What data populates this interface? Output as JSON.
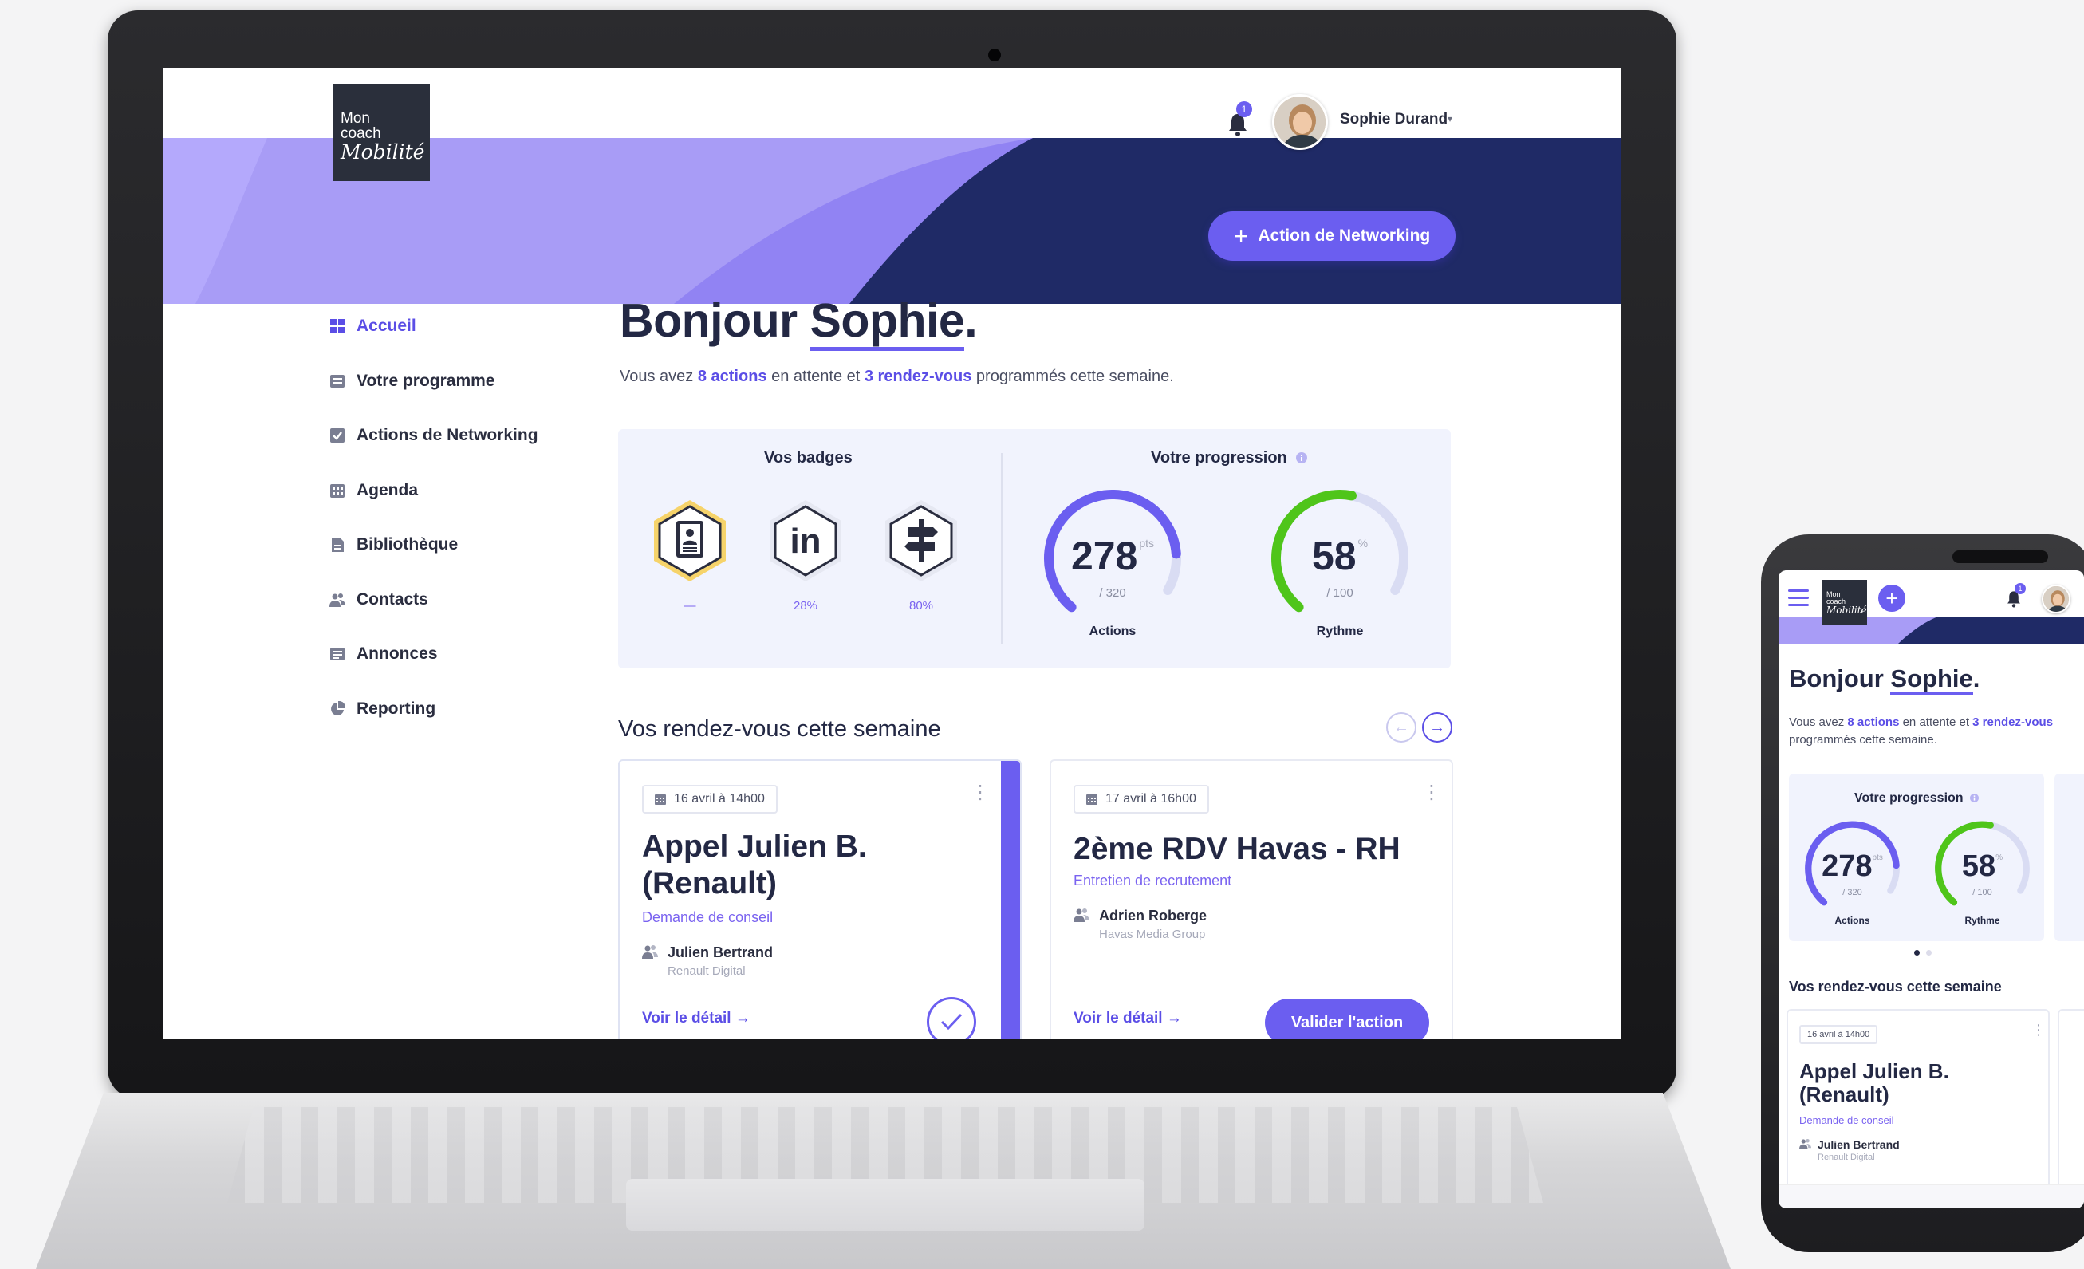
{
  "colors": {
    "accent": "#6b5ef0",
    "navy": "#1f2a66",
    "light_band": "#a89cf6",
    "success": "#4fc51a",
    "text": "#232844"
  },
  "app": {
    "logo_line1": "Mon",
    "logo_line2": "coach",
    "logo_line3": "Mobilité"
  },
  "header": {
    "notifications_count": "1",
    "notification_icon": "bell-icon",
    "user_name": "Sophie Durand",
    "user_caret": "▾",
    "primary_action_icon": "plus-icon",
    "primary_action_label": "Action de Networking"
  },
  "sidebar": {
    "items": [
      {
        "label": "Accueil",
        "icon": "grid-icon",
        "active": true
      },
      {
        "label": "Votre programme",
        "icon": "list-icon",
        "active": false
      },
      {
        "label": "Actions de Networking",
        "icon": "checkbox-icon",
        "active": false
      },
      {
        "label": "Agenda",
        "icon": "calendar-icon",
        "active": false
      },
      {
        "label": "Bibliothèque",
        "icon": "document-icon",
        "active": false
      },
      {
        "label": "Contacts",
        "icon": "people-icon",
        "active": false
      },
      {
        "label": "Annonces",
        "icon": "newspaper-icon",
        "active": false
      },
      {
        "label": "Reporting",
        "icon": "pie-chart-icon",
        "active": false
      }
    ]
  },
  "greeting": {
    "prefix": "Bonjour ",
    "name": "Sophie",
    "suffix": ".",
    "summary": {
      "part1": "Vous avez ",
      "actions": "8 actions",
      "part2": " en attente et ",
      "rdv": "3 rendez-vous",
      "part3": " programmés cette semaine."
    }
  },
  "badges": {
    "title": "Vos badges",
    "items": [
      {
        "icon": "resume-icon",
        "value": "—",
        "unlocked": true
      },
      {
        "icon": "linkedin-icon",
        "value": "28%",
        "unlocked": false
      },
      {
        "icon": "signpost-icon",
        "value": "80%",
        "unlocked": false
      }
    ]
  },
  "progression": {
    "title": "Votre progression",
    "info_icon": "info-icon",
    "gauges": [
      {
        "value": "278",
        "unit": "pts",
        "max": "/ 320",
        "label": "Actions",
        "fraction": 0.869,
        "color": "#6b5ef0"
      },
      {
        "value": "58",
        "unit": "%",
        "max": "/ 100",
        "label": "Rythme",
        "fraction": 0.58,
        "color": "#4fc51a"
      }
    ]
  },
  "appointments": {
    "title": "Vos rendez-vous cette semaine",
    "prev_icon": "arrow-left-icon",
    "next_icon": "arrow-right-icon",
    "cards": [
      {
        "date": "16 avril à 14h00",
        "title": "Appel Julien B. (Renault)",
        "title_line1": "Appel Julien B.",
        "title_line2": "(Renault)",
        "type": "Demande de conseil",
        "person": "Julien Bertrand",
        "company": "Renault Digital",
        "link": "Voir le détail →",
        "selected": true
      },
      {
        "date": "17 avril à 16h00",
        "title": "2ème RDV Havas - RH",
        "type": "Entretien de recrutement",
        "person": "Adrien Roberge",
        "company": "Havas Media Group",
        "link": "Voir le détail →",
        "action": "Valider l'action",
        "selected": false
      }
    ]
  }
}
